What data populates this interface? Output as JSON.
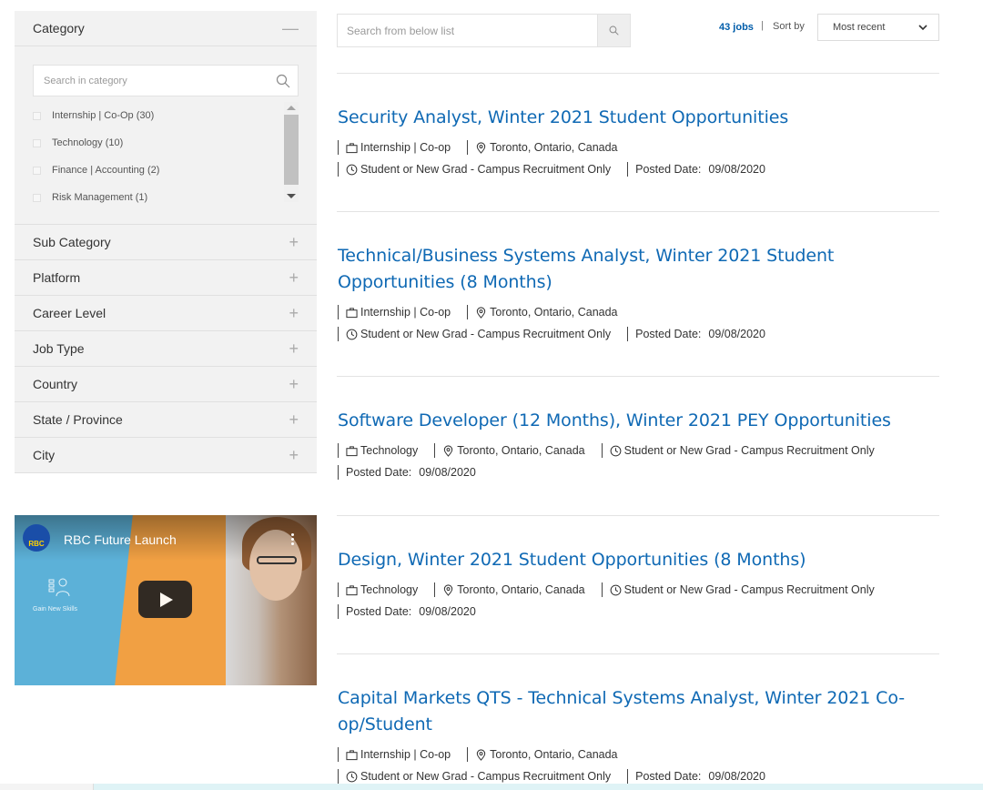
{
  "sidebar": {
    "category": {
      "title": "Category",
      "search_placeholder": "Search in category",
      "items": [
        {
          "label": "Internship | Co-Op (30)"
        },
        {
          "label": "Technology (10)"
        },
        {
          "label": "Finance | Accounting (2)"
        },
        {
          "label": "Risk Management (1)"
        }
      ]
    },
    "sections": [
      {
        "title": "Sub Category"
      },
      {
        "title": "Platform"
      },
      {
        "title": "Career Level"
      },
      {
        "title": "Job Type"
      },
      {
        "title": "Country"
      },
      {
        "title": "State / Province"
      },
      {
        "title": "City"
      }
    ],
    "collapse_sign": "—",
    "expand_sign": "+"
  },
  "video": {
    "title": "RBC Future Launch",
    "logo_text": "RBC",
    "skill_label": "Gain New Skills"
  },
  "search": {
    "placeholder": "Search from below list"
  },
  "results": {
    "count_label": "43 jobs",
    "separator": "|",
    "sort_label": "Sort by",
    "sort_value": "Most recent"
  },
  "jobs": [
    {
      "title": "Security Analyst, Winter 2021 Student Opportunities",
      "category": "Internship | Co-op",
      "location": "Toronto, Ontario, Canada",
      "level": "Student or New Grad - Campus Recruitment Only",
      "posted_label": "Posted Date:",
      "posted_date": "09/08/2020"
    },
    {
      "title": "Technical/Business Systems Analyst, Winter 2021 Student Opportunities (8 Months)",
      "category": "Internship | Co-op",
      "location": "Toronto, Ontario, Canada",
      "level": "Student or New Grad - Campus Recruitment Only",
      "posted_label": "Posted Date:",
      "posted_date": "09/08/2020"
    },
    {
      "title": "Software Developer (12 Months), Winter 2021 PEY Opportunities",
      "category": "Technology",
      "location": "Toronto, Ontario, Canada",
      "level": "Student or New Grad - Campus Recruitment Only",
      "posted_label": "Posted Date:",
      "posted_date": "09/08/2020"
    },
    {
      "title": "Design, Winter 2021 Student Opportunities (8 Months)",
      "category": "Technology",
      "location": "Toronto, Ontario, Canada",
      "level": "Student or New Grad - Campus Recruitment Only",
      "posted_label": "Posted Date:",
      "posted_date": "09/08/2020"
    },
    {
      "title": "Capital Markets QTS - Technical Systems Analyst, Winter 2021 Co-op/Student",
      "category": "Internship | Co-op",
      "location": "Toronto, Ontario, Canada",
      "level": "Student or New Grad - Campus Recruitment Only",
      "posted_label": "Posted Date:",
      "posted_date": "09/08/2020"
    }
  ],
  "colors": {
    "link": "#0f69b4",
    "count": "#005daa",
    "sidebar_bg": "#f2f2f2"
  }
}
